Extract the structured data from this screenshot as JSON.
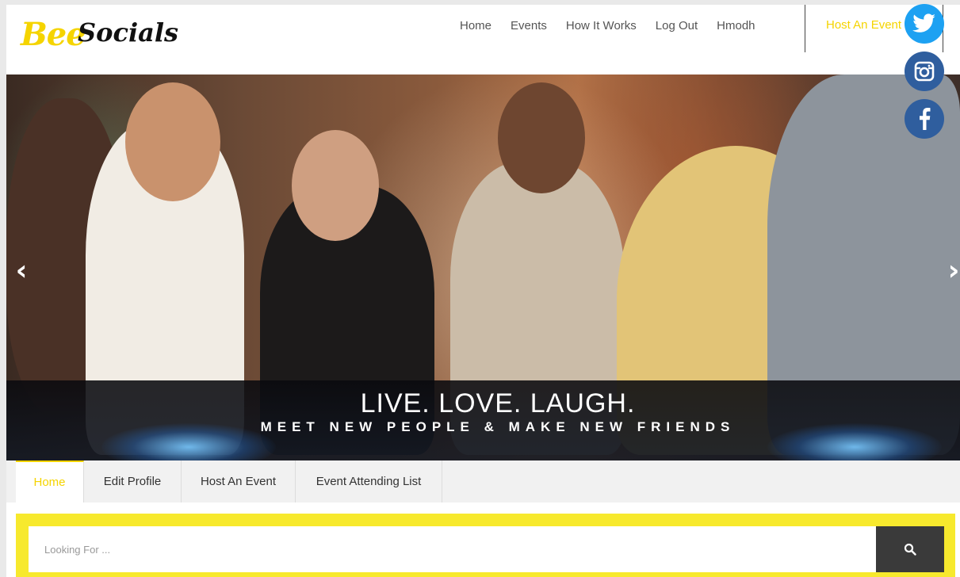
{
  "brand": {
    "logo_part1": "Bee",
    "logo_part2": "Socials"
  },
  "nav": {
    "items": [
      "Home",
      "Events",
      "How It Works",
      "Log Out",
      "Hmodh"
    ],
    "cta": "Host An Event"
  },
  "social": {
    "icons": [
      "twitter-icon",
      "instagram-icon",
      "facebook-icon"
    ],
    "twitter_color": "#1da1f2",
    "brand_blue": "#2f5e9e"
  },
  "hero": {
    "headline": "LIVE. LOVE. LAUGH.",
    "subline": "MEET NEW PEOPLE & MAKE NEW FRIENDS",
    "prev_glyph": "‹",
    "next_glyph": "›"
  },
  "tabs": {
    "items": [
      "Home",
      "Edit Profile",
      "Host An Event",
      "Event Attending List"
    ],
    "active": "Home"
  },
  "search": {
    "placeholder": "Looking For ..."
  },
  "colors": {
    "accent": "#f5d400",
    "search_band": "#f7e92d",
    "search_button": "#3a3a3a"
  }
}
